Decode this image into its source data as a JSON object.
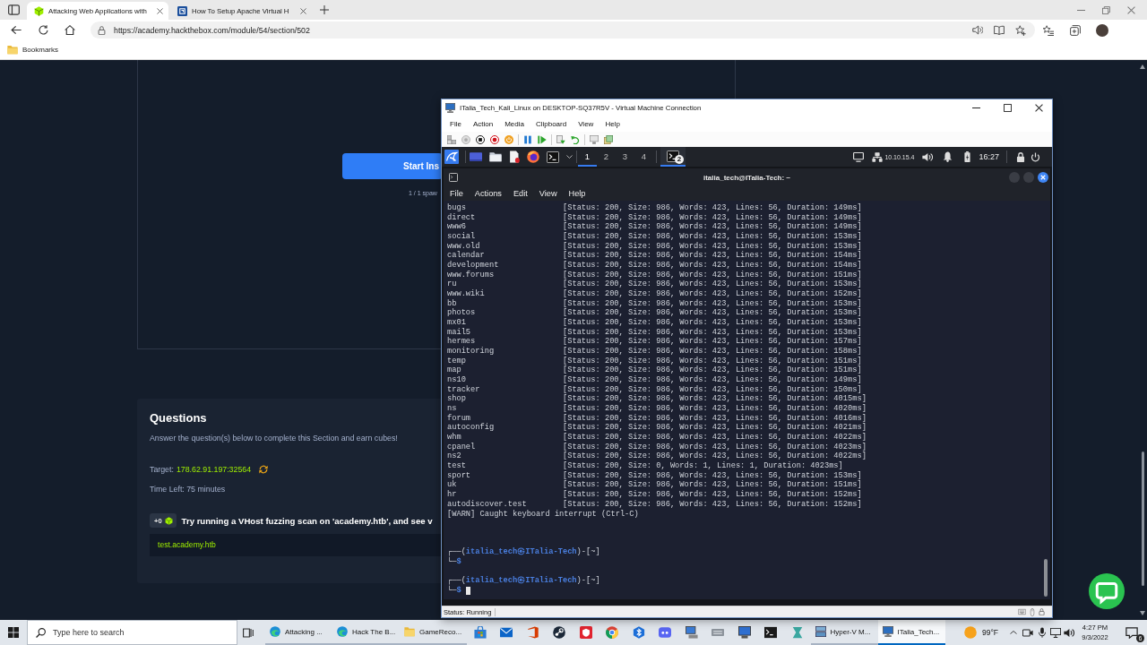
{
  "browser": {
    "tabs": [
      {
        "title": "Attacking Web Applications with",
        "selected": true
      },
      {
        "title": "How To Setup Apache Virtual H",
        "selected": false
      }
    ],
    "address": "https://academy.hackthebox.com/module/54/section/502",
    "bookmarks_folder": "Bookmarks"
  },
  "page": {
    "instance": {
      "start_button": "Start Ins",
      "spawns_left": "1 / 1 spaw"
    },
    "questions": {
      "title": "Questions",
      "intro": "Answer the question(s) below to complete this Section and earn cubes!",
      "target": {
        "label": "Target:",
        "value": "178.62.91.197:32564"
      },
      "time_left": "Time Left: 75 minutes",
      "items": [
        {
          "reward": "+0",
          "question": "Try running a VHost fuzzing scan on 'academy.htb', and see v",
          "answer": "test.academy.htb"
        }
      ]
    }
  },
  "vm_window": {
    "title": "ITalia_Tech_Kali_Linux on DESKTOP-SQ37R5V - Virtual Machine Connection",
    "menu": [
      "File",
      "Action",
      "Media",
      "Clipboard",
      "View",
      "Help"
    ],
    "guest_panel": {
      "workspaces": [
        {
          "label": "1",
          "selected": true
        },
        {
          "label": "2",
          "selected": false
        },
        {
          "label": "3",
          "selected": false
        },
        {
          "label": "4",
          "selected": false
        }
      ],
      "terminal_task_badge": "2",
      "ip_address": "10.10.15.4",
      "time": "16:27"
    },
    "terminal": {
      "title": "italia_tech@ITalia-Tech: ~",
      "menu": [
        "File",
        "Actions",
        "Edit",
        "View",
        "Help"
      ],
      "results": [
        {
          "host": "bugs",
          "result": "[Status: 200, Size: 986, Words: 423, Lines: 56, Duration: 149ms]"
        },
        {
          "host": "direct",
          "result": "[Status: 200, Size: 986, Words: 423, Lines: 56, Duration: 149ms]"
        },
        {
          "host": "www6",
          "result": "[Status: 200, Size: 986, Words: 423, Lines: 56, Duration: 149ms]"
        },
        {
          "host": "social",
          "result": "[Status: 200, Size: 986, Words: 423, Lines: 56, Duration: 153ms]"
        },
        {
          "host": "www.old",
          "result": "[Status: 200, Size: 986, Words: 423, Lines: 56, Duration: 153ms]"
        },
        {
          "host": "calendar",
          "result": "[Status: 200, Size: 986, Words: 423, Lines: 56, Duration: 154ms]"
        },
        {
          "host": "development",
          "result": "[Status: 200, Size: 986, Words: 423, Lines: 56, Duration: 154ms]"
        },
        {
          "host": "www.forums",
          "result": "[Status: 200, Size: 986, Words: 423, Lines: 56, Duration: 151ms]"
        },
        {
          "host": "ru",
          "result": "[Status: 200, Size: 986, Words: 423, Lines: 56, Duration: 153ms]"
        },
        {
          "host": "www.wiki",
          "result": "[Status: 200, Size: 986, Words: 423, Lines: 56, Duration: 152ms]"
        },
        {
          "host": "bb",
          "result": "[Status: 200, Size: 986, Words: 423, Lines: 56, Duration: 153ms]"
        },
        {
          "host": "photos",
          "result": "[Status: 200, Size: 986, Words: 423, Lines: 56, Duration: 153ms]"
        },
        {
          "host": "mx01",
          "result": "[Status: 200, Size: 986, Words: 423, Lines: 56, Duration: 153ms]"
        },
        {
          "host": "mail5",
          "result": "[Status: 200, Size: 986, Words: 423, Lines: 56, Duration: 153ms]"
        },
        {
          "host": "hermes",
          "result": "[Status: 200, Size: 986, Words: 423, Lines: 56, Duration: 157ms]"
        },
        {
          "host": "monitoring",
          "result": "[Status: 200, Size: 986, Words: 423, Lines: 56, Duration: 158ms]"
        },
        {
          "host": "temp",
          "result": "[Status: 200, Size: 986, Words: 423, Lines: 56, Duration: 151ms]"
        },
        {
          "host": "map",
          "result": "[Status: 200, Size: 986, Words: 423, Lines: 56, Duration: 151ms]"
        },
        {
          "host": "ns10",
          "result": "[Status: 200, Size: 986, Words: 423, Lines: 56, Duration: 149ms]"
        },
        {
          "host": "tracker",
          "result": "[Status: 200, Size: 986, Words: 423, Lines: 56, Duration: 150ms]"
        },
        {
          "host": "shop",
          "result": "[Status: 200, Size: 986, Words: 423, Lines: 56, Duration: 4015ms]"
        },
        {
          "host": "ns",
          "result": "[Status: 200, Size: 986, Words: 423, Lines: 56, Duration: 4020ms]"
        },
        {
          "host": "forum",
          "result": "[Status: 200, Size: 986, Words: 423, Lines: 56, Duration: 4016ms]"
        },
        {
          "host": "autoconfig",
          "result": "[Status: 200, Size: 986, Words: 423, Lines: 56, Duration: 4021ms]"
        },
        {
          "host": "whm",
          "result": "[Status: 200, Size: 986, Words: 423, Lines: 56, Duration: 4022ms]"
        },
        {
          "host": "cpanel",
          "result": "[Status: 200, Size: 986, Words: 423, Lines: 56, Duration: 4023ms]"
        },
        {
          "host": "ns2",
          "result": "[Status: 200, Size: 986, Words: 423, Lines: 56, Duration: 4022ms]"
        },
        {
          "host": "test",
          "result": "[Status: 200, Size: 0, Words: 1, Lines: 1, Duration: 4023ms]"
        },
        {
          "host": "sport",
          "result": "[Status: 200, Size: 986, Words: 423, Lines: 56, Duration: 153ms]"
        },
        {
          "host": "uk",
          "result": "[Status: 200, Size: 986, Words: 423, Lines: 56, Duration: 151ms]"
        },
        {
          "host": "hr",
          "result": "[Status: 200, Size: 986, Words: 423, Lines: 56, Duration: 152ms]"
        },
        {
          "host": "autodiscover.test",
          "result": "[Status: 200, Size: 986, Words: 423, Lines: 56, Duration: 152ms]"
        }
      ],
      "warning": "[WARN] Caught keyboard interrupt (Ctrl-C)",
      "prompts": [
        {
          "header": "┌──(**italia_tech㉿ITalia-Tech**)-[~]",
          "input": "└─**$**",
          "cursor": false
        },
        {
          "header": "┌──(**italia_tech㉿ITalia-Tech**)-[~]",
          "input": "└─**$**",
          "cursor": true
        }
      ]
    },
    "status": "Status: Running"
  },
  "taskbar": {
    "search_placeholder": "Type here to search",
    "windows": [
      {
        "label": "Attacking ...",
        "selected": false
      },
      {
        "label": "Hack The B...",
        "selected": false
      },
      {
        "label": "GameReco...",
        "selected": false
      },
      {
        "label": "Hyper-V M...",
        "selected": false
      },
      {
        "label": "ITalia_Tech...",
        "selected": true
      }
    ],
    "temperature": "99°F",
    "clock": {
      "time": "4:27 PM",
      "date": "9/3/2022"
    },
    "notification_count": "6"
  }
}
